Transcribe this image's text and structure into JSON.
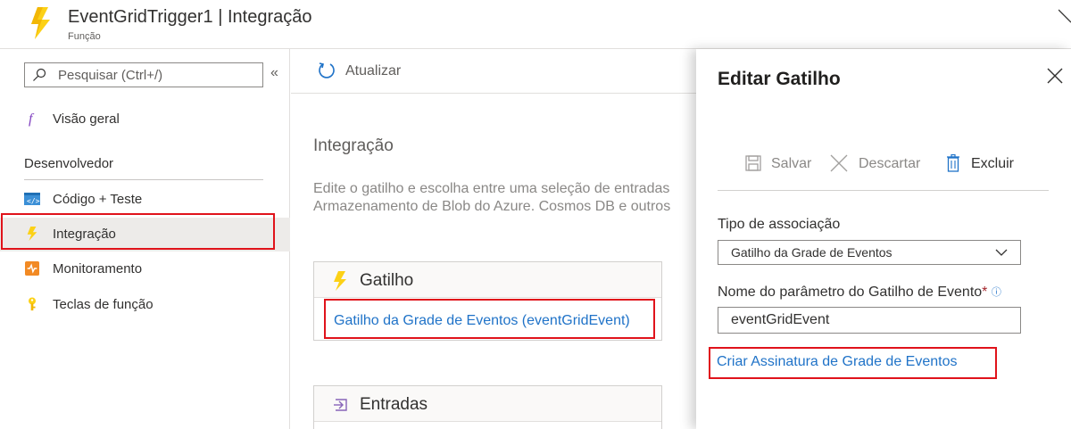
{
  "header": {
    "title": "EventGridTrigger1 | Integração",
    "subtitle": "Função"
  },
  "sidebar": {
    "search_placeholder": "Pesquisar (Ctrl+/)",
    "collapse_label": "«",
    "overview_label": "Visão geral",
    "section_developer": "Desenvolvedor",
    "items": [
      {
        "label": "Código + Teste",
        "icon": "code-icon"
      },
      {
        "label": "Integração",
        "icon": "lightning-bolt-icon",
        "selected": true
      },
      {
        "label": "Monitoramento",
        "icon": "monitor-icon"
      },
      {
        "label": "Teclas de função",
        "icon": "key-icon"
      }
    ]
  },
  "toolbar": {
    "refresh_label": "Atualizar"
  },
  "main": {
    "title": "Integração",
    "description_line1": "Edite o gatilho e escolha entre uma seleção de entradas",
    "description_line2": "Armazenamento de Blob do Azure. Cosmos DB e outros",
    "trigger_card": {
      "title": "Gatilho",
      "link": "Gatilho da Grade de Eventos (eventGridEvent)"
    },
    "inputs_card": {
      "title": "Entradas"
    }
  },
  "panel": {
    "title": "Editar Gatilho",
    "save_label": "Salvar",
    "discard_label": "Descartar",
    "delete_label": "Excluir",
    "binding_type_label": "Tipo de associação",
    "binding_type_value": "Gatilho da Grade de Eventos",
    "param_name_label": "Nome do parâmetro do Gatilho de Evento",
    "required_marker": "*",
    "info_marker": "ⓘ",
    "param_name_value": "eventGridEvent",
    "create_subscription_link": "Criar Assinatura de Grade de Eventos"
  },
  "colors": {
    "accent_link": "#2073c8",
    "highlight_red": "#e0131b",
    "bolt_yellow": "#fcd116"
  }
}
